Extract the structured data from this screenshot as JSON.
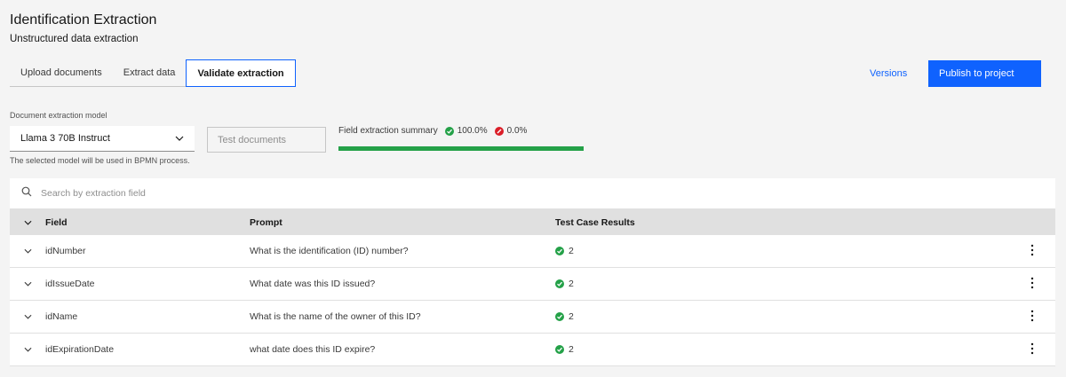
{
  "header": {
    "title": "Identification Extraction",
    "subtitle": "Unstructured data extraction"
  },
  "tabs": [
    {
      "label": "Upload documents",
      "active": false
    },
    {
      "label": "Extract data",
      "active": false
    },
    {
      "label": "Validate extraction",
      "active": true
    }
  ],
  "actions": {
    "versions_label": "Versions",
    "publish_label": "Publish to project"
  },
  "model": {
    "label": "Document extraction model",
    "selected": "Llama 3 70B Instruct",
    "helper": "The selected model will be used in BPMN process."
  },
  "test_documents_label": "Test documents",
  "summary": {
    "label": "Field extraction summary",
    "success_pct": "100.0%",
    "fail_pct": "0.0%",
    "progress_fraction": 1.0
  },
  "search": {
    "placeholder": "Search by extraction field"
  },
  "table": {
    "headers": {
      "field": "Field",
      "prompt": "Prompt",
      "results": "Test Case Results"
    },
    "rows": [
      {
        "field": "idNumber",
        "prompt": "What is the identification (ID) number?",
        "result": "2"
      },
      {
        "field": "idIssueDate",
        "prompt": "What date was this ID issued?",
        "result": "2"
      },
      {
        "field": "idName",
        "prompt": "What is the name of the owner of this ID?",
        "result": "2"
      },
      {
        "field": "idExpirationDate",
        "prompt": "what date does this ID expire?",
        "result": "2"
      }
    ]
  },
  "colors": {
    "primary": "#0f62fe",
    "success": "#24a148",
    "error": "#da1e28"
  }
}
